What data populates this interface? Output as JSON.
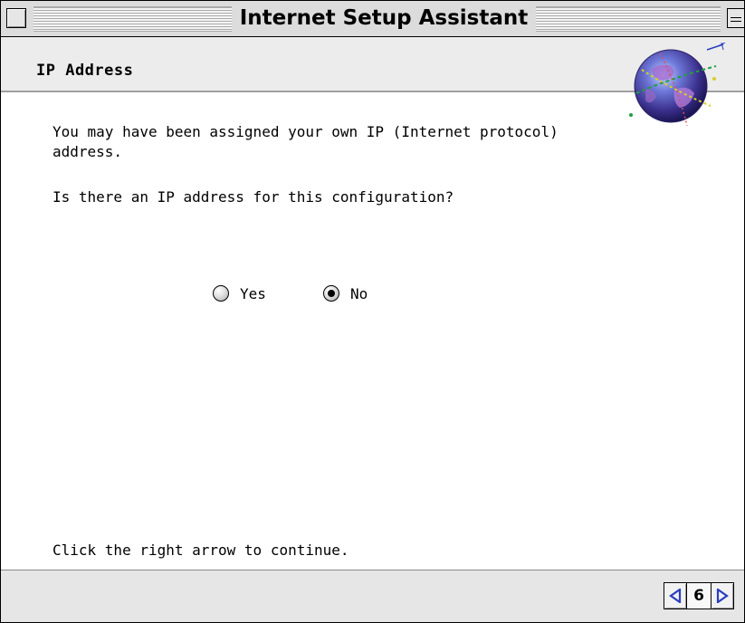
{
  "window": {
    "title": "Internet Setup Assistant"
  },
  "header": {
    "title": "IP Address",
    "illustration_icon": "globe-icon"
  },
  "body": {
    "paragraph1": "You may have been assigned your own IP (Internet protocol) address.",
    "paragraph2": "Is there an IP address for this configuration?"
  },
  "ip_choice": {
    "options": [
      {
        "label": "Yes",
        "selected": false
      },
      {
        "label": "No",
        "selected": true
      }
    ]
  },
  "footer": {
    "hint": "Click the right arrow to continue.",
    "page_number": "6",
    "prev_icon": "left-arrow-icon",
    "next_icon": "right-arrow-icon"
  },
  "colors": {
    "arrow": "#2a3fbf",
    "header_band": "#ececec",
    "bottom_bar": "#e6e6e6"
  }
}
